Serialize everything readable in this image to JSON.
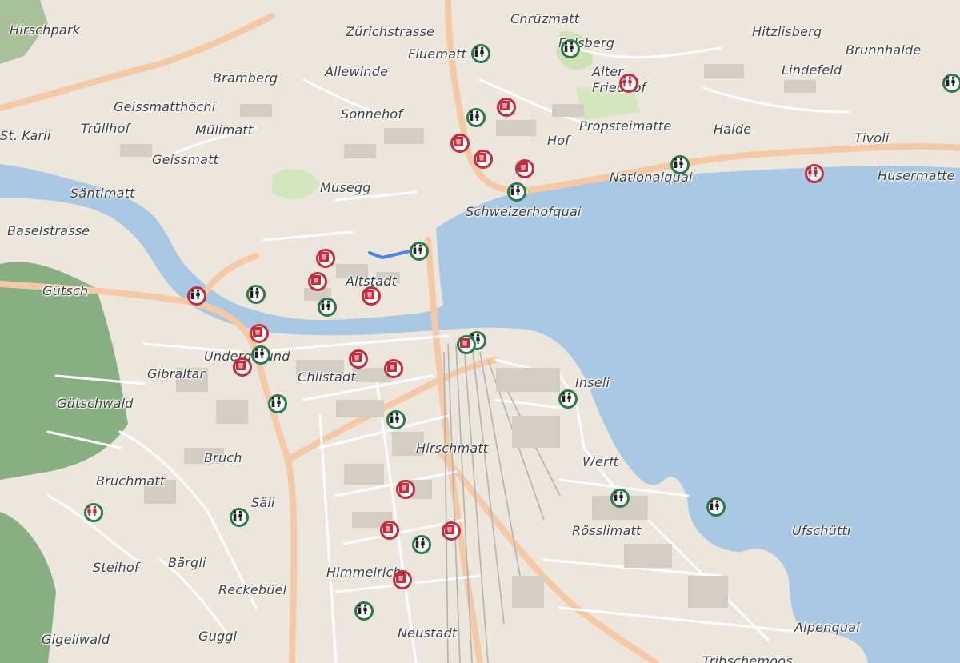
{
  "map": {
    "colors": {
      "land": "#ece6dc",
      "water": "#a9c8e4",
      "forest": "#77a571",
      "park": "#cfe2b6",
      "road_major": "#f5c9a6",
      "road_minor": "#ffffff",
      "rail": "#c7c7c7",
      "marker_green": "#2a7a4a",
      "marker_red": "#c62c3b"
    },
    "labels": [
      "Hirschpark",
      "Zürichstrasse",
      "Chrüzmatt",
      "Fluematt",
      "Felsberg",
      "Hitzlisberg",
      "Brunnhalde",
      "Alter",
      "Friedhof",
      "Lindefeld",
      "Bramberg",
      "Allewinde",
      "Geissmatthöchi",
      "Sonnehof",
      "Trüllhof",
      "Mülimatt",
      "St. Karli",
      "Propsteimatte",
      "Halde",
      "Tivoli",
      "Hof",
      "Geissmatt",
      "Nationalquai",
      "Husermatte",
      "Musegg",
      "Säntimatt",
      "Schweizerhofquai",
      "Baselstrasse",
      "Altstadt",
      "Gütsch",
      "Underground",
      "Chlistadt",
      "Gibraltar",
      "Inseli",
      "Gütschwald",
      "Hirschmatt",
      "Bruch",
      "Werft",
      "Bruchmatt",
      "Säli",
      "Rösslimatt",
      "Ufschütti",
      "Steihof",
      "Bärgli",
      "Reckebüel",
      "Himmelrich",
      "Gigeliwald",
      "Guggi",
      "Neustadt",
      "Alpenquai",
      "Tribschemoos"
    ],
    "markers": [
      {
        "kind": "toilet",
        "status": "open"
      },
      {
        "kind": "toilet",
        "status": "open"
      },
      {
        "kind": "toilet-female",
        "status": "closed"
      },
      {
        "kind": "toilet",
        "status": "open"
      },
      {
        "kind": "bin",
        "status": "closed"
      },
      {
        "kind": "bin",
        "status": "closed"
      },
      {
        "kind": "bin",
        "status": "closed"
      },
      {
        "kind": "bin",
        "status": "closed"
      },
      {
        "kind": "toilet",
        "status": "open"
      },
      {
        "kind": "toilet",
        "status": "open"
      },
      {
        "kind": "toilet-female",
        "status": "closed"
      },
      {
        "kind": "toilet",
        "status": "open"
      },
      {
        "kind": "toilet",
        "status": "open"
      },
      {
        "kind": "bin",
        "status": "closed"
      },
      {
        "kind": "bin",
        "status": "closed"
      },
      {
        "kind": "toilet",
        "status": "open"
      },
      {
        "kind": "bin",
        "status": "closed"
      },
      {
        "kind": "toilet",
        "status": "closed"
      },
      {
        "kind": "bin",
        "status": "closed"
      },
      {
        "kind": "toilet",
        "status": "open"
      },
      {
        "kind": "bin",
        "status": "closed"
      },
      {
        "kind": "bin",
        "status": "closed"
      },
      {
        "kind": "bin",
        "status": "closed"
      },
      {
        "kind": "toilet",
        "status": "open"
      },
      {
        "kind": "toilet",
        "status": "open"
      },
      {
        "kind": "toilet",
        "status": "open"
      },
      {
        "kind": "bin",
        "status": "open"
      },
      {
        "kind": "toilet",
        "status": "open"
      },
      {
        "kind": "toilet",
        "status": "open"
      },
      {
        "kind": "toilet",
        "status": "open"
      },
      {
        "kind": "toilet",
        "status": "open"
      },
      {
        "kind": "toilet-female",
        "status": "open"
      },
      {
        "kind": "toilet",
        "status": "open"
      },
      {
        "kind": "bin",
        "status": "closed"
      },
      {
        "kind": "bin",
        "status": "closed"
      },
      {
        "kind": "bin",
        "status": "closed"
      },
      {
        "kind": "toilet",
        "status": "open"
      },
      {
        "kind": "bin",
        "status": "closed"
      },
      {
        "kind": "toilet",
        "status": "open"
      }
    ]
  }
}
